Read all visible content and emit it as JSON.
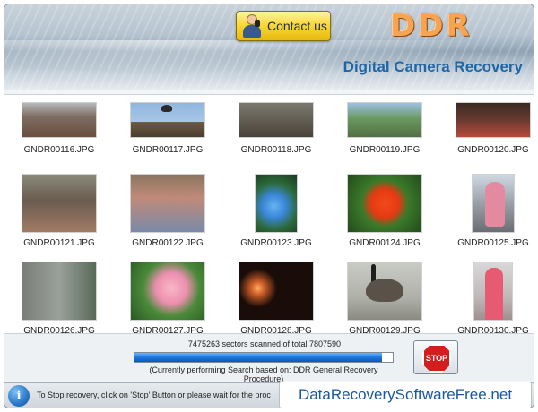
{
  "header": {
    "contact_label": "Contact us",
    "logo": "DDR",
    "app_title": "Digital Camera Recovery"
  },
  "files": [
    {
      "name": "GNDR00116.JPG",
      "icon": "photo-thumbnail"
    },
    {
      "name": "GNDR00117.JPG",
      "icon": "photo-thumbnail"
    },
    {
      "name": "GNDR00118.JPG",
      "icon": "photo-thumbnail"
    },
    {
      "name": "GNDR00119.JPG",
      "icon": "photo-thumbnail"
    },
    {
      "name": "GNDR00120.JPG",
      "icon": "photo-thumbnail"
    },
    {
      "name": "GNDR00121.JPG",
      "icon": "photo-thumbnail"
    },
    {
      "name": "GNDR00122.JPG",
      "icon": "photo-thumbnail"
    },
    {
      "name": "GNDR00123.JPG",
      "icon": "photo-thumbnail"
    },
    {
      "name": "GNDR00124.JPG",
      "icon": "photo-thumbnail"
    },
    {
      "name": "GNDR00125.JPG",
      "icon": "photo-thumbnail"
    },
    {
      "name": "GNDR00126.JPG",
      "icon": "photo-thumbnail"
    },
    {
      "name": "GNDR00127.JPG",
      "icon": "photo-thumbnail"
    },
    {
      "name": "GNDR00128.JPG",
      "icon": "photo-thumbnail"
    },
    {
      "name": "GNDR00129.JPG",
      "icon": "photo-thumbnail"
    },
    {
      "name": "GNDR00130.JPG",
      "icon": "photo-thumbnail"
    }
  ],
  "scan": {
    "status_text": "7475263 sectors scanned of total 7807590",
    "progress_fraction": 0.957,
    "method_text": "(Currently performing Search based on:  DDR General Recovery Procedure)",
    "stop_label": "STOP"
  },
  "status_bar": {
    "icon": "info-icon",
    "message": "To Stop recovery, click on 'Stop' Button or please wait for the proc",
    "website": "DataRecoverySoftwareFree.net"
  },
  "colors": {
    "accent_blue": "#1f66a6",
    "logo_orange": "#f6a451",
    "progress_blue": "#1c78e0",
    "stop_red": "#d21e1e"
  }
}
